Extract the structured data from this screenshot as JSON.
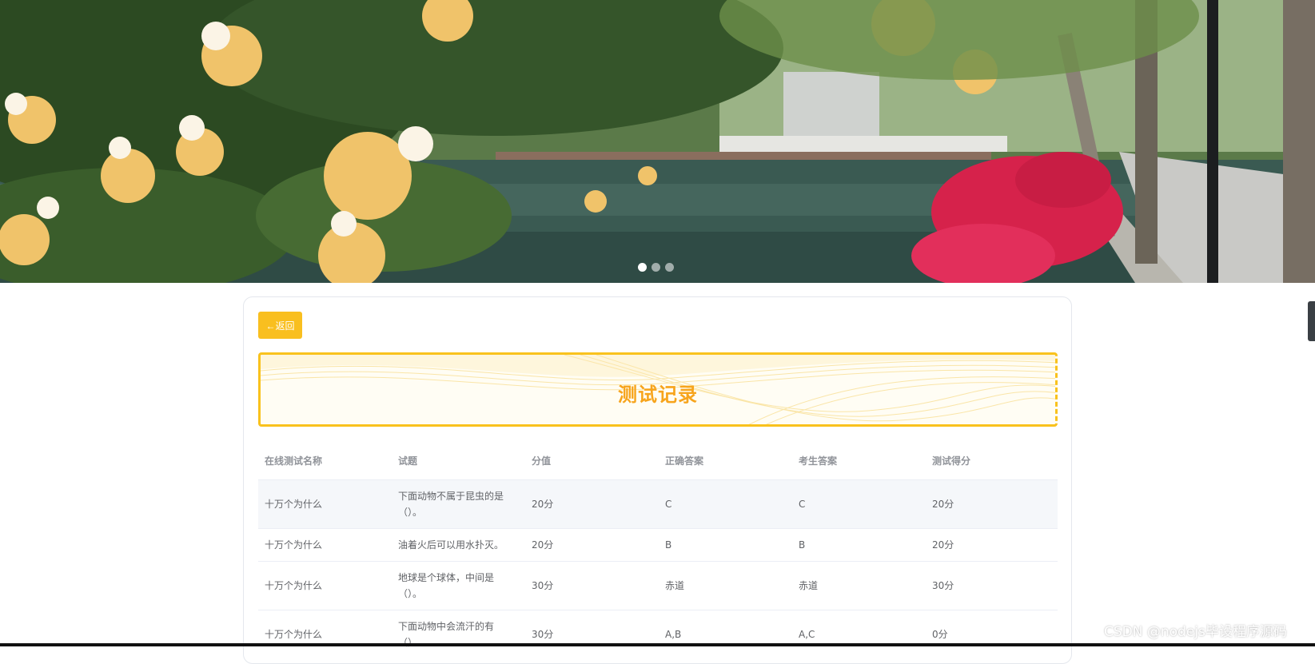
{
  "carousel": {
    "slide_count": 3,
    "active_index": 0
  },
  "card": {
    "back_label": "←返回",
    "title": "测试记录"
  },
  "table": {
    "headers": [
      "在线测试名称",
      "试题",
      "分值",
      "正确答案",
      "考生答案",
      "测试得分"
    ],
    "rows": [
      [
        "十万个为什么",
        "下面动物不属于昆虫的是（）。",
        "20分",
        "C",
        "C",
        "20分"
      ],
      [
        "十万个为什么",
        "油着火后可以用水扑灭。",
        "20分",
        "B",
        "B",
        "20分"
      ],
      [
        "十万个为什么",
        "地球是个球体，中间是（）。",
        "30分",
        "赤道",
        "赤道",
        "30分"
      ],
      [
        "十万个为什么",
        "下面动物中会流汗的有（）。",
        "30分",
        "A,B",
        "A,C",
        "0分"
      ]
    ]
  },
  "watermark": "CSDN @nodejs毕设程序源码",
  "colors": {
    "accent": "#f9bf1f",
    "title": "#f7a41c",
    "header_text": "#909399",
    "body_text": "#606266",
    "row_highlight": "#f5f7fa"
  }
}
